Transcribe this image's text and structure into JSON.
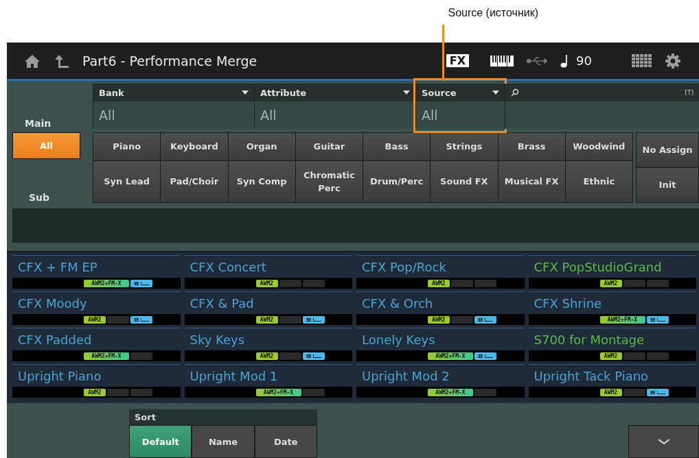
{
  "annotation": {
    "label": "Source (источник)"
  },
  "header": {
    "title": "Part6 - Performance Merge",
    "fx_label": "FX",
    "tempo": "90"
  },
  "filters": [
    {
      "kind": "dropdown",
      "label": "Bank",
      "value": "All",
      "highlighted": false
    },
    {
      "kind": "dropdown",
      "label": "Attribute",
      "value": "All",
      "highlighted": false
    },
    {
      "kind": "dropdown",
      "label": "Source",
      "value": "All",
      "highlighted": true
    },
    {
      "kind": "search",
      "badge": "[T]"
    }
  ],
  "main_label": "Main",
  "sub_label": "Sub",
  "main_all": {
    "label": "All",
    "selected": true
  },
  "categories": [
    [
      {
        "label": "Piano",
        "selected": false
      },
      {
        "label": "Keyboard",
        "selected": false
      },
      {
        "label": "Organ",
        "selected": false
      },
      {
        "label": "Guitar",
        "selected": false
      },
      {
        "label": "Bass",
        "selected": false
      },
      {
        "label": "Strings",
        "selected": false
      },
      {
        "label": "Brass",
        "selected": false
      },
      {
        "label": "Woodwind",
        "selected": false
      }
    ],
    [
      {
        "label": "Syn Lead",
        "selected": false
      },
      {
        "label": "Pad/Choir",
        "selected": false
      },
      {
        "label": "Syn Comp",
        "selected": false
      },
      {
        "label": "Chromatic Perc",
        "selected": false
      },
      {
        "label": "Drum/Perc",
        "selected": false
      },
      {
        "label": "Sound FX",
        "selected": false
      },
      {
        "label": "Musical FX",
        "selected": false
      },
      {
        "label": "Ethnic",
        "selected": false
      }
    ]
  ],
  "side_buttons": [
    {
      "label": "No Assign"
    },
    {
      "label": "Init"
    }
  ],
  "performances": [
    {
      "name": "CFX + FM EP",
      "color": "#4aa3d6",
      "slots": [
        {
          "kind": "wide",
          "label": "AWM2+FM-X"
        },
        {
          "kind": "arp"
        }
      ]
    },
    {
      "name": "CFX Concert",
      "color": "#4aa3d6",
      "slots": [
        {
          "kind": "engine",
          "label": "AWM2"
        },
        {
          "kind": "empty"
        },
        {
          "kind": "empty"
        }
      ]
    },
    {
      "name": "CFX Pop/Rock",
      "color": "#4aa3d6",
      "slots": [
        {
          "kind": "engine",
          "label": "AWM2"
        },
        {
          "kind": "empty"
        },
        {
          "kind": "empty"
        }
      ]
    },
    {
      "name": "CFX PopStudioGrand",
      "color": "#5cb84a",
      "slots": [
        {
          "kind": "engine",
          "label": "AWM2"
        },
        {
          "kind": "empty"
        },
        {
          "kind": "empty"
        }
      ]
    },
    {
      "name": "CFX Moody",
      "color": "#4aa3d6",
      "slots": [
        {
          "kind": "engine",
          "label": "AWM2"
        },
        {
          "kind": "empty"
        },
        {
          "kind": "arp"
        }
      ]
    },
    {
      "name": "CFX & Pad",
      "color": "#4aa3d6",
      "slots": [
        {
          "kind": "engine",
          "label": "AWM2"
        },
        {
          "kind": "empty"
        },
        {
          "kind": "arp"
        }
      ]
    },
    {
      "name": "CFX & Orch",
      "color": "#4aa3d6",
      "slots": [
        {
          "kind": "engine",
          "label": "AWM2"
        },
        {
          "kind": "empty"
        },
        {
          "kind": "arp"
        }
      ]
    },
    {
      "name": "CFX Shrine",
      "color": "#4aa3d6",
      "slots": [
        {
          "kind": "wide",
          "label": "AWM2+FM-X"
        },
        {
          "kind": "arp"
        }
      ]
    },
    {
      "name": "CFX Padded",
      "color": "#4aa3d6",
      "slots": [
        {
          "kind": "wide",
          "label": "AWM2+FM-X"
        },
        {
          "kind": "empty"
        }
      ]
    },
    {
      "name": "Sky Keys",
      "color": "#4aa3d6",
      "slots": [
        {
          "kind": "engine",
          "label": "AWM2"
        },
        {
          "kind": "empty"
        },
        {
          "kind": "arp"
        }
      ]
    },
    {
      "name": "Lonely Keys",
      "color": "#4aa3d6",
      "slots": [
        {
          "kind": "wide",
          "label": "AWM2+FM-X"
        },
        {
          "kind": "arp"
        }
      ]
    },
    {
      "name": "S700 for Montage",
      "color": "#5cb84a",
      "slots": [
        {
          "kind": "engine",
          "label": "AWM2"
        },
        {
          "kind": "empty"
        },
        {
          "kind": "empty"
        }
      ]
    },
    {
      "name": "Upright Piano",
      "color": "#4aa3d6",
      "slots": [
        {
          "kind": "engine",
          "label": "AWM2"
        },
        {
          "kind": "empty"
        },
        {
          "kind": "empty"
        }
      ]
    },
    {
      "name": "Upright Mod 1",
      "color": "#4aa3d6",
      "slots": [
        {
          "kind": "wide",
          "label": "AWM2+FM-X"
        },
        {
          "kind": "empty"
        }
      ]
    },
    {
      "name": "Upright Mod 2",
      "color": "#4aa3d6",
      "slots": [
        {
          "kind": "wide",
          "label": "AWM2+FM-X"
        },
        {
          "kind": "empty"
        }
      ]
    },
    {
      "name": "Upright Tack Piano",
      "color": "#4aa3d6",
      "slots": [
        {
          "kind": "engine",
          "label": "AWM2"
        },
        {
          "kind": "empty"
        },
        {
          "kind": "arp"
        }
      ]
    }
  ],
  "sort": {
    "label": "Sort",
    "options": [
      {
        "label": "Default",
        "selected": true
      },
      {
        "label": "Name",
        "selected": false
      },
      {
        "label": "Date",
        "selected": false
      }
    ]
  }
}
